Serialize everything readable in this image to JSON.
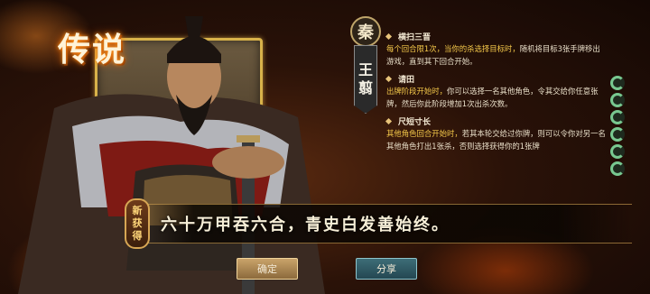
{
  "legend_title": "传说",
  "general": {
    "faction": "秦",
    "name_chars": [
      "王",
      "翦"
    ]
  },
  "skills": [
    {
      "name": "横扫三晋",
      "desc_highlight": "每个回合限1次，当你的杀选择目标时，",
      "desc": "随机将目标3张手牌移出游戏，直到其下回合开始。"
    },
    {
      "name": "请田",
      "desc_highlight": "出牌阶段开始时，",
      "desc": "你可以选择一名其他角色，令其交给你任意张牌，然后你此阶段增加1次出杀次数。"
    },
    {
      "name": "尺短寸长",
      "desc_highlight": "其他角色回合开始时，",
      "desc": "若其本轮交给过你牌，则可以令你对另一名其他角色打出1张杀，否则选择获得你的1张牌"
    }
  ],
  "new_badge_chars": [
    "新",
    "获",
    "得"
  ],
  "quote": "六十万甲吞六合，青史白发善始终。",
  "buttons": {
    "confirm": "确定",
    "share": "分享"
  },
  "scale_count": 6
}
